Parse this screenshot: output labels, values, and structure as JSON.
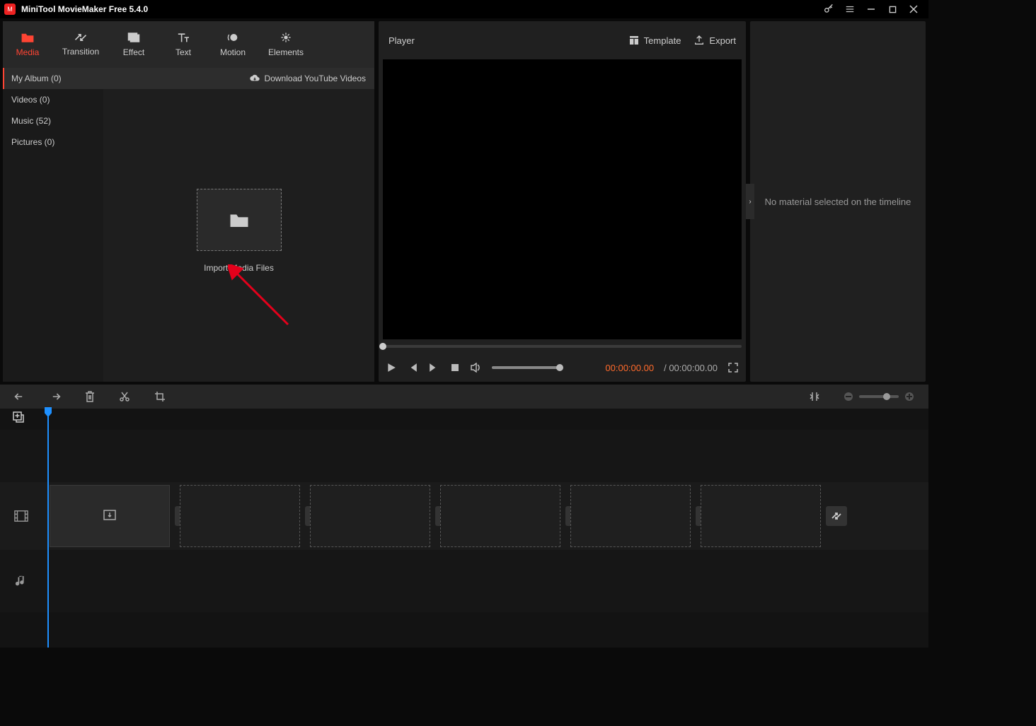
{
  "app": {
    "title": "MiniTool MovieMaker Free 5.4.0"
  },
  "tabs": [
    {
      "label": "Media",
      "active": true
    },
    {
      "label": "Transition"
    },
    {
      "label": "Effect"
    },
    {
      "label": "Text"
    },
    {
      "label": "Motion"
    },
    {
      "label": "Elements"
    }
  ],
  "sidebar": {
    "items": [
      {
        "label": "My Album (0)",
        "active": true
      },
      {
        "label": "Videos (0)"
      },
      {
        "label": "Music (52)"
      },
      {
        "label": "Pictures (0)"
      }
    ]
  },
  "media": {
    "download_label": "Download YouTube Videos",
    "import_label": "Import Media Files"
  },
  "player": {
    "title": "Player",
    "template_label": "Template",
    "export_label": "Export",
    "current_time": "00:00:00.00",
    "total_time": "00:00:00.00",
    "separator": "/ "
  },
  "inspector": {
    "empty_message": "No material selected on the timeline"
  }
}
